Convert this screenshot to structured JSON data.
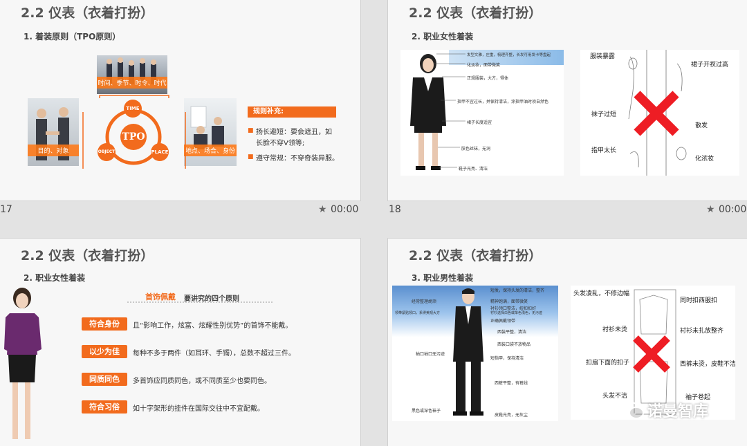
{
  "colors": {
    "accent": "#f26b1d",
    "cross": "#ee1d24",
    "title": "#555555"
  },
  "slides": [
    {
      "number": "17",
      "time": "00:00",
      "title": "2.2 仪表（衣着打扮）",
      "subtitle": "1. 着装原则（TPO原则）",
      "photo_top_caption": "时间、季节、时令、时代",
      "photo_left_caption": "目的、对象",
      "photo_right_caption": "地点、场合、身份",
      "tpo_center": "TPO",
      "tpo_time": "TIME",
      "tpo_object": "OBJECT",
      "tpo_place": "PLACE",
      "rules_header": "规则补充:",
      "rule1_line1": "扬长避短：要会遮丑，如",
      "rule1_line2": "长脸不穿V领等;",
      "rule2": "遵守常规：不穿奇装异服。"
    },
    {
      "number": "18",
      "time": "00:00",
      "title": "2.2 仪表（衣着打扮）",
      "subtitle": "2. 职业女性着装",
      "annotations": [
        "发型文雅，庄重，梳理齐整，长发可用发卡等盘起",
        "化淡妆，面带微笑",
        "正规服装，大方，得体",
        "指甲不宜过长，并保持清洁，涂指甲油时须自然色",
        "裙子长度适宜",
        "肤色丝袜，无洞",
        "鞋子光亮、清洁"
      ],
      "wrong_labels": {
        "l1": "服装暴露",
        "l2": "袜子过短",
        "l3": "指甲太长",
        "r1": "裙子开衩过高",
        "r2": "散发",
        "r3": "化浓妆"
      }
    },
    {
      "title": "2.2 仪表（衣着打扮）",
      "subtitle": "2. 职业女性着装",
      "header_em": "首饰佩戴",
      "header_rest": "要讲究的四个原则",
      "principles": [
        {
          "label": "符合身份",
          "text": "且“影响工作，炫富、炫耀性别优势”的首饰不能戴。"
        },
        {
          "label": "以少为佳",
          "text": "每种不多于两件（如耳环、手镯），总数不超过三件。"
        },
        {
          "label": "同质同色",
          "text": "多首饰应同质同色，或不同质至少也要同色。"
        },
        {
          "label": "符合习俗",
          "text": "如十字架形的挂件在国际交往中不宜配戴。"
        }
      ]
    },
    {
      "title": "2.2 仪表（衣着打扮）",
      "subtitle": "3. 职业男性着装",
      "annotations_left": [
        "经常整理胡须",
        "领带紧贴领口，系得美观大方",
        "袖口袖口无污迹",
        "黑色或深色袜子"
      ],
      "annotations_right": [
        "短发，保持头发的清洁，整齐",
        "精神饱满，面带微笑",
        "衬衫领口整洁，纽扣扣好",
        "衬衫选择白色或单色浅色，无污迹",
        "正确佩戴领带",
        "西装平整，清洁",
        "西装口袋不放物品",
        "短指甲，保持清洁",
        "西裤平整，有裤线",
        "皮鞋光亮，无灰尘"
      ],
      "wrong_labels": {
        "l1": "头发凌乱，不修边幅",
        "l2": "衬衫未烫",
        "l3": "扣扇下面的扣子",
        "l4": "头发不洁",
        "r1": "同时扣西服扣",
        "r2": "衬衫未扎放整齐",
        "r3": "西裤未烫，皮鞋不洁",
        "r4": "袖子卷起"
      }
    }
  ],
  "watermark": "诺曼智库"
}
